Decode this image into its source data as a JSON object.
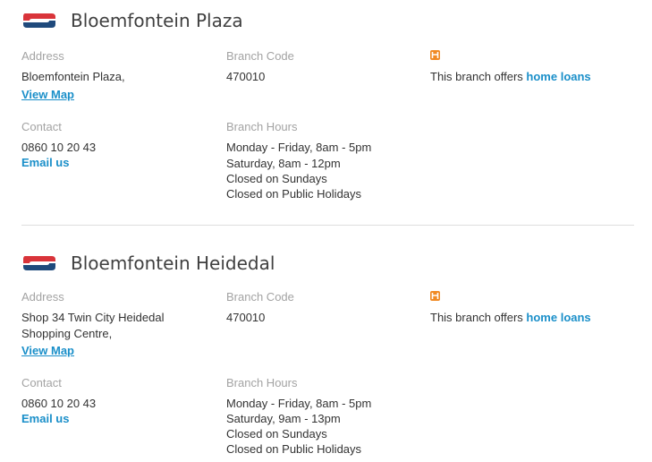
{
  "branches": [
    {
      "name": "Bloemfontein Plaza",
      "address_label": "Address",
      "address_lines": [
        "Bloemfontein Plaza,"
      ],
      "view_map": "View Map",
      "branch_code_label": "Branch Code",
      "branch_code": "470010",
      "offers_prefix": "This branch offers ",
      "offers_link": "home loans",
      "contact_label": "Contact",
      "phone": "0860 10 20 43",
      "email_link": "Email us",
      "hours_label": "Branch Hours",
      "hours": [
        "Monday - Friday, 8am - 5pm",
        "Saturday, 8am - 12pm",
        "Closed on Sundays",
        "Closed on Public Holidays"
      ]
    },
    {
      "name": "Bloemfontein Heidedal",
      "address_label": "Address",
      "address_lines": [
        "Shop 34 Twin City Heidedal",
        "Shopping Centre,"
      ],
      "view_map": "View Map",
      "branch_code_label": "Branch Code",
      "branch_code": "470010",
      "offers_prefix": "This branch offers ",
      "offers_link": "home loans",
      "contact_label": "Contact",
      "phone": "0860 10 20 43",
      "email_link": "Email us",
      "hours_label": "Branch Hours",
      "hours": [
        "Monday - Friday, 8am - 5pm",
        "Saturday, 9am - 13pm",
        "Closed on Sundays",
        "Closed on Public Holidays"
      ]
    }
  ],
  "colors": {
    "logo_red": "#d9343a",
    "logo_blue": "#1f4a7c",
    "link": "#1a8fc9",
    "home_loan_icon": "#f08a24"
  },
  "icons": {
    "logo": "capitec-logo-icon",
    "home_loan": "home-loan-icon"
  }
}
